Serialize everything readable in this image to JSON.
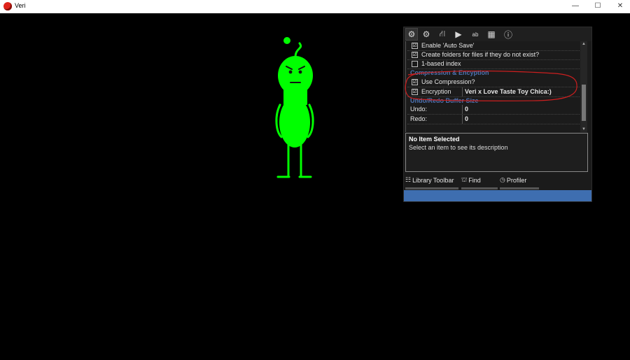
{
  "window": {
    "title": "Veri",
    "minimize": "—",
    "maximize": "☐",
    "close": "✕"
  },
  "toolbar": {
    "icons": [
      "gear-icon-active",
      "gear-icon",
      "hierarchy-icon",
      "play-icon",
      "ab-icon",
      "grid-icon",
      "info-icon"
    ],
    "glyphs": {
      "gear": "⚙",
      "hierarchy": "⛙",
      "play": "▶",
      "ab": "ab",
      "grid": "▦",
      "info": "ⓘ"
    }
  },
  "properties": {
    "rows": [
      {
        "label": "Enable 'Auto Save'",
        "checked": true,
        "mark": "☑"
      },
      {
        "label": "Create folders for files if they do not exist?",
        "checked": true,
        "mark": "☑"
      },
      {
        "label": "1-based index",
        "checked": false,
        "mark": ""
      }
    ],
    "section_compression": "Compression & Encyption",
    "use_compression": {
      "label": "Use Compression?",
      "checked": true,
      "mark": "☑"
    },
    "encryption": {
      "label": "Encryption",
      "checked": true,
      "mark": "☑",
      "value": "Veri x Love Taste Toy Chica:)"
    },
    "section_undo": "Undo/Redo Buffer Size",
    "undo": {
      "label": "Undo:",
      "value": "0"
    },
    "redo": {
      "label": "Redo:",
      "value": "0"
    }
  },
  "description": {
    "title": "No Item Selected",
    "text": "Select an item to see its description"
  },
  "bottom_tabs": [
    {
      "label": "Library Toolbar",
      "icon": "library-icon",
      "glyph": "☷"
    },
    {
      "label": "Find",
      "icon": "binoculars-icon",
      "glyph": "⛫"
    },
    {
      "label": "Profiler",
      "icon": "clock-icon",
      "glyph": "◷"
    }
  ],
  "colors": {
    "character": "#00ff00",
    "annotation": "#cc1f1f",
    "panel_bg": "#1b1b1b",
    "section_header": "#4d73b3",
    "accent_bar": "#3e6eb0"
  }
}
